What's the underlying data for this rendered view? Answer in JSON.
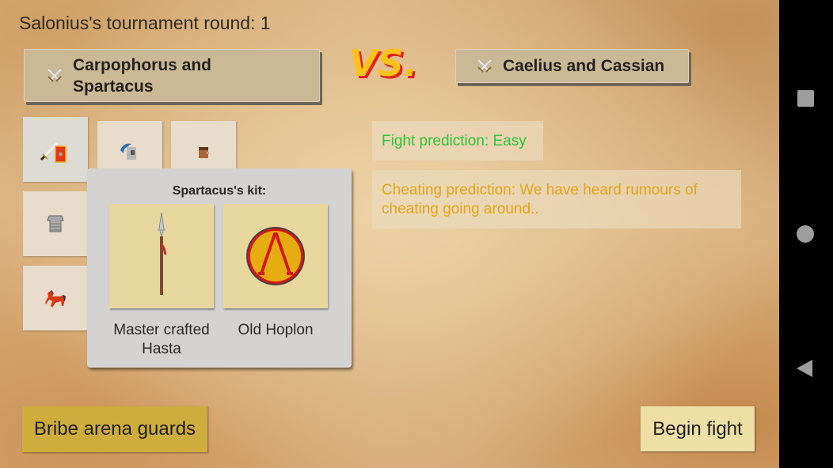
{
  "header": {
    "title": "Salonius's tournament round: 1"
  },
  "match": {
    "left_team": {
      "name": "Carpophorus  and Spartacus",
      "icon": "crossed-swords-icon"
    },
    "vs_label": "VS.",
    "right_team": {
      "name": "Caelius and Cassian",
      "icon": "crossed-swords-icon"
    }
  },
  "equipment_slots": [
    {
      "name": "weapon-shield",
      "icon": "sword-and-scutum-icon",
      "selected": true
    },
    {
      "name": "helmet",
      "icon": "plumed-helmet-icon"
    },
    {
      "name": "head",
      "icon": "head-icon"
    },
    {
      "name": "armor",
      "icon": "chest-armor-icon"
    },
    {
      "name": "mount",
      "icon": "horse-icon"
    }
  ],
  "kit_panel": {
    "title": "Spartacus's kit:",
    "items": [
      {
        "label": "Master crafted Hasta",
        "icon": "spear-icon"
      },
      {
        "label": "Old Hoplon",
        "icon": "lambda-shield-icon"
      }
    ]
  },
  "predictions": {
    "fight": {
      "text": "Fight prediction: Easy",
      "color": "#2ec33e"
    },
    "cheating": {
      "text": "Cheating prediction: We have heard rumours of cheating going around..",
      "color": "#e0a620"
    }
  },
  "actions": {
    "bribe_label": "Bribe arena guards",
    "begin_label": "Begin fight"
  },
  "system_nav": [
    "recents",
    "home",
    "back"
  ]
}
